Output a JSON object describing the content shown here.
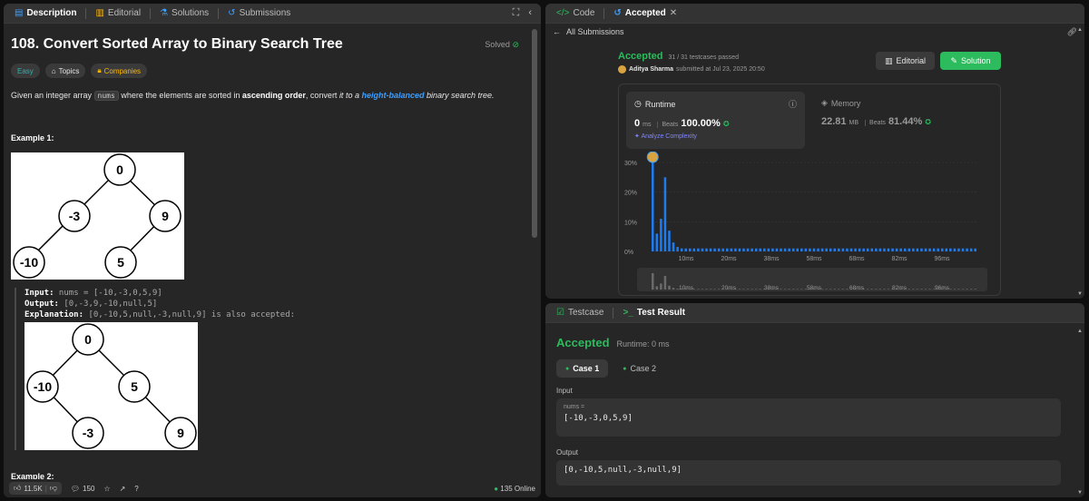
{
  "left": {
    "tabs": [
      {
        "label": "Description",
        "icon": "description-icon"
      },
      {
        "label": "Editorial",
        "icon": "book-icon"
      },
      {
        "label": "Solutions",
        "icon": "flask-icon"
      },
      {
        "label": "Submissions",
        "icon": "history-icon"
      }
    ],
    "title": "108. Convert Sorted Array to Binary Search Tree",
    "solved_label": "Solved",
    "chips": {
      "difficulty": "Easy",
      "topics": "Topics",
      "companies": "Companies"
    },
    "description": {
      "p1": "Given an integer array ",
      "code": "nums",
      "p2": " where the elements are sorted in ",
      "bold": "ascending order",
      "p3": ", convert ",
      "italic1": "it to a ",
      "link": "height-balanced",
      "italic2": " binary search tree."
    },
    "example1": {
      "title": "Example 1:",
      "tree1_nodes": [
        "0",
        "-3",
        "9",
        "-10",
        "5"
      ],
      "input_label": "Input:",
      "input_value": " nums = [-10,-3,0,5,9]",
      "output_label": "Output:",
      "output_value": " [0,-3,9,-10,null,5]",
      "explanation_label": "Explanation:",
      "explanation_value": " [0,-10,5,null,-3,null,9] is also accepted:",
      "tree2_nodes": [
        "0",
        "-10",
        "5",
        "-3",
        "9"
      ]
    },
    "example2_title": "Example 2:",
    "footer": {
      "likes": "11.5K",
      "comments": "150",
      "online": "135 Online"
    }
  },
  "right_top": {
    "tabs": [
      {
        "label": "Code",
        "icon": "code-icon"
      },
      {
        "label": "Accepted",
        "icon": "history-icon"
      }
    ],
    "back_label": "All Submissions",
    "status": "Accepted",
    "testcases": "31 / 31 testcases passed",
    "user": "Aditya Sharma",
    "submitted_text": "submitted at Jul 23, 2025 20:50",
    "editorial_btn": "Editorial",
    "solution_btn": "Solution",
    "runtime": {
      "label": "Runtime",
      "value": "0",
      "unit": "ms",
      "beats_label": "Beats",
      "beats": "100.00%",
      "analyze": "Analyze Complexity"
    },
    "memory": {
      "label": "Memory",
      "value": "22.81",
      "unit": "MB",
      "beats_label": "Beats",
      "beats": "81.44%"
    }
  },
  "chart_data": {
    "type": "bar",
    "ylabel_ticks": [
      "30%",
      "20%",
      "10%",
      "0%"
    ],
    "ylim": [
      0,
      30
    ],
    "xticks": [
      "10ms",
      "20ms",
      "38ms",
      "58ms",
      "68ms",
      "82ms",
      "96ms"
    ],
    "values": [
      30,
      6,
      11,
      25,
      7,
      3,
      1.5,
      1,
      1,
      1,
      1,
      1,
      1,
      1,
      1,
      1,
      1,
      1,
      1,
      1,
      1,
      1,
      1,
      1,
      1,
      1,
      1,
      1,
      1,
      1,
      1,
      1,
      1,
      1,
      1,
      1,
      1,
      1,
      1,
      1,
      1,
      1,
      1,
      1,
      1,
      1,
      1,
      1,
      1,
      1,
      1,
      1,
      1,
      1,
      1,
      1,
      1,
      1,
      1,
      1,
      1,
      1,
      1,
      1,
      1,
      1,
      1,
      1,
      1,
      1,
      1,
      1,
      1,
      1,
      1,
      1,
      1,
      1,
      1
    ],
    "highlight_index": 0,
    "grid": true
  },
  "right_bottom": {
    "tabs": [
      {
        "label": "Testcase",
        "icon": "checkbox-icon"
      },
      {
        "label": "Test Result",
        "icon": "terminal-icon"
      }
    ],
    "status": "Accepted",
    "runtime": "Runtime: 0 ms",
    "cases": [
      "Case 1",
      "Case 2"
    ],
    "input_label": "Input",
    "input_key": "nums =",
    "input_value": "[-10,-3,0,5,9]",
    "output_label": "Output",
    "output_value": "[0,-10,5,null,-3,null,9]"
  },
  "colors": {
    "accent_green": "#2cbb5d",
    "link_blue": "#3c9fff",
    "bar_blue": "#1f7cf0"
  }
}
